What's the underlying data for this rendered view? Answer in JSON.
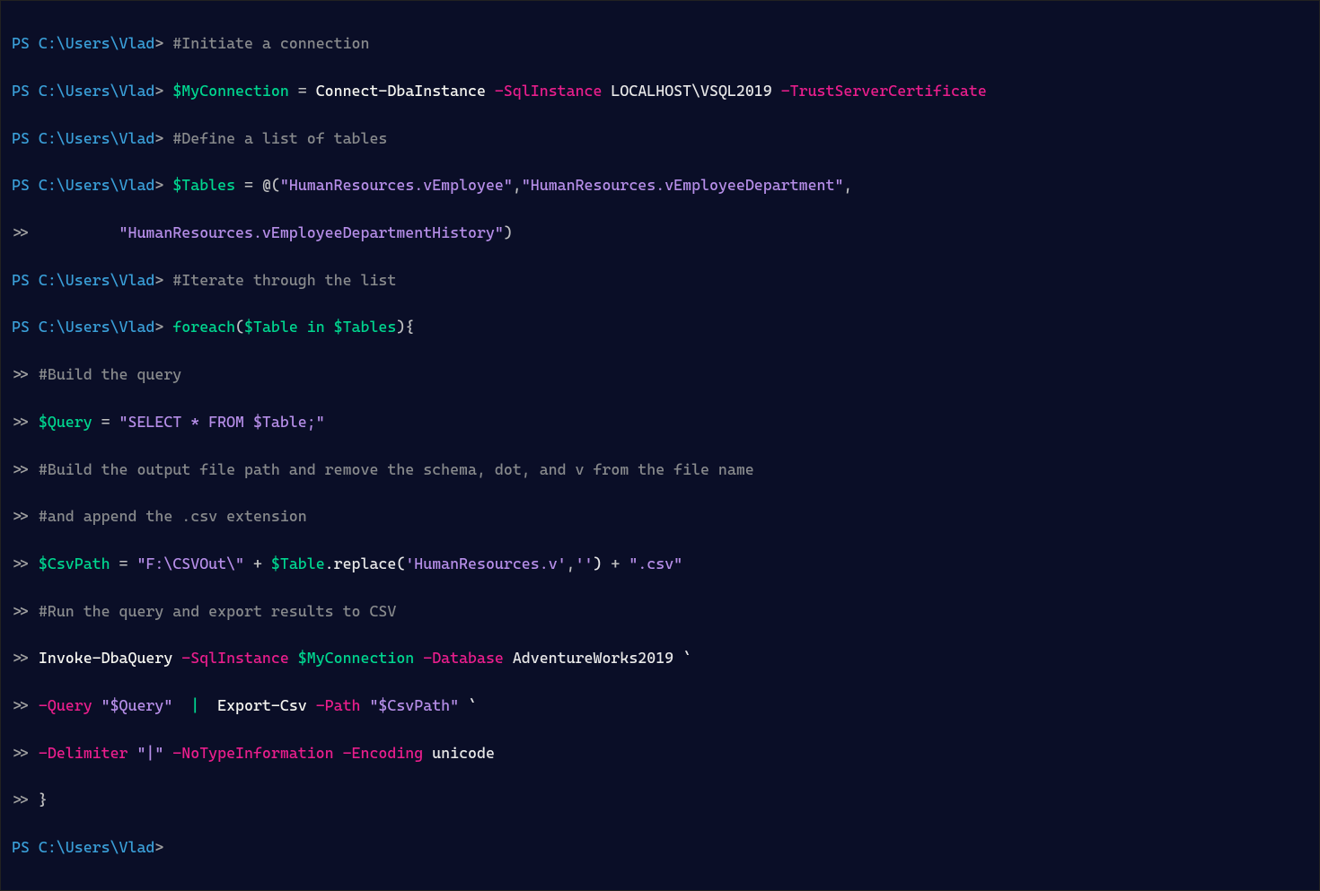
{
  "colors": {
    "bg": "#0a0e27",
    "prompt": "#3a9fd8",
    "comment": "#888a8c",
    "variable": "#00d68f",
    "param": "#e91e8c",
    "string": "#b68ee8",
    "text": "#e8e8e8"
  },
  "prompt": {
    "ps": "PS ",
    "path": "C:\\Users\\Vlad",
    "gt": "> ",
    "cont": ">> "
  },
  "lines": {
    "l1_comment": "#Initiate a connection",
    "l2_var": "$MyConnection",
    "l2_eq": " = ",
    "l2_cmd": "Connect-DbaInstance",
    "l2_p1": " -SqlInstance",
    "l2_a1": " LOCALHOST\\VSQL2019",
    "l2_p2": " -TrustServerCertificate",
    "l3_comment": "#Define a list of tables",
    "l4_var": "$Tables",
    "l4_eq": " = ",
    "l4_at": "@(",
    "l4_s1": "\"HumanResources.vEmployee\"",
    "l4_c1": ",",
    "l4_s2": "\"HumanResources.vEmployeeDepartment\"",
    "l4_c2": ",",
    "l5_pad": "         ",
    "l5_s": "\"HumanResources.vEmployeeDepartmentHistory\"",
    "l5_close": ")",
    "l6_comment": "#Iterate through the list",
    "l7_kw": "foreach",
    "l7_open": "(",
    "l7_var1": "$Table",
    "l7_in": " in ",
    "l7_var2": "$Tables",
    "l7_close": "){",
    "l8_comment": "#Build the query",
    "l9_var": "$Query",
    "l9_eq": " = ",
    "l9_str": "\"SELECT * FROM $Table;\"",
    "l10_comment": "#Build the output file path and remove the schema, dot, and v from the file name",
    "l11_comment": "#and append the .csv extension",
    "l12_var": "$CsvPath",
    "l12_eq": " = ",
    "l12_s1": "\"F:\\CSVOut\\\"",
    "l12_plus1": " + ",
    "l12_var2": "$Table",
    "l12_method": ".replace(",
    "l12_arg1": "'HumanResources.v'",
    "l12_comma": ",",
    "l12_arg2": "''",
    "l12_mclose": ")",
    "l12_plus2": " + ",
    "l12_s2": "\".csv\"",
    "l13_comment": "#Run the query and export results to CSV",
    "l14_cmd": "Invoke-DbaQuery",
    "l14_p1": " -SqlInstance",
    "l14_v1": " $MyConnection",
    "l14_p2": " -Database",
    "l14_a2": " AdventureWorks2019",
    "l14_tick": " `",
    "l15_p1": "-Query",
    "l15_s1": " \"$Query\"",
    "l15_pipe": "  |  ",
    "l15_cmd": "Export-Csv",
    "l15_p2": " -Path",
    "l15_s2": " \"$CsvPath\"",
    "l15_tick": " `",
    "l16_p1": "-Delimiter",
    "l16_s1": " \"|\"",
    "l16_p2": " -NoTypeInformation",
    "l16_p3": " -Encoding",
    "l16_a3": " unicode",
    "l17_brace": "}"
  }
}
